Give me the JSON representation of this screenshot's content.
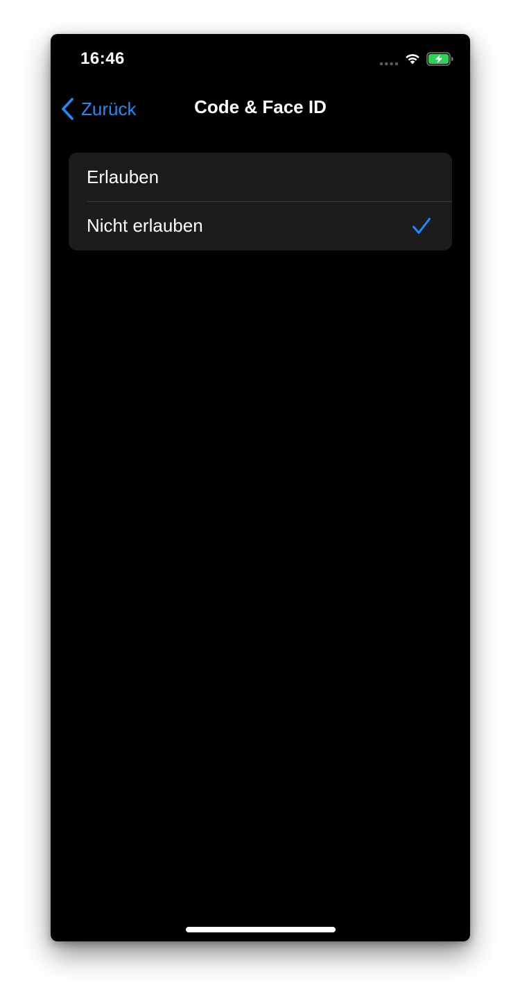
{
  "status_bar": {
    "time": "16:46",
    "battery_color": "#30d158"
  },
  "nav": {
    "back_label": "Zurück",
    "title": "Code & Face ID",
    "accent_color": "#1a8cff"
  },
  "options": [
    {
      "label": "Erlauben",
      "selected": false
    },
    {
      "label": "Nicht erlauben",
      "selected": true
    }
  ],
  "icons": {
    "back": "chevron-left-icon",
    "selected": "checkmark-icon",
    "wifi": "wifi-icon",
    "battery": "battery-charging-icon",
    "signal": "signal-dots-icon"
  }
}
